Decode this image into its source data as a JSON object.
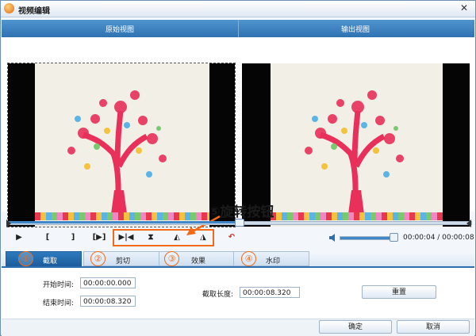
{
  "window": {
    "title": "视频编辑",
    "close_glyph": "✕"
  },
  "views": {
    "original_label": "原始视图",
    "output_label": "输出视图"
  },
  "playback": {
    "buttons": [
      {
        "name": "play-button",
        "glyph": "▶"
      },
      {
        "name": "mark-in-button",
        "glyph": "["
      },
      {
        "name": "mark-out-button",
        "glyph": "]"
      },
      {
        "name": "preview-selection-button",
        "glyph": "[▶]"
      }
    ],
    "rotate_buttons": [
      {
        "name": "flip-horizontal-button",
        "glyph": "▶|◀"
      },
      {
        "name": "flip-vertical-button",
        "glyph": "⧗"
      },
      {
        "name": "rotate-left-button",
        "glyph": "◭"
      },
      {
        "name": "rotate-right-button",
        "glyph": "◮"
      }
    ],
    "undo_glyph": "↶",
    "progress_fraction": 0.5,
    "volume_fraction": 0.95,
    "time_text": "00:00:04 / 00:00:08"
  },
  "annotation": {
    "label": "⑤旋转按钮",
    "color": "#f06a1a"
  },
  "tabs": [
    {
      "number": "①",
      "label": "截取"
    },
    {
      "number": "②",
      "label": "剪切"
    },
    {
      "number": "③",
      "label": "效果"
    },
    {
      "number": "④",
      "label": "水印"
    }
  ],
  "trim": {
    "start_label": "开始时间:",
    "start_value": "00:00:00.000",
    "end_label": "结束时间:",
    "end_value": "00:00:08.320",
    "length_label": "截取长度:",
    "length_value": "00:00:08.320",
    "reset_label": "重置"
  },
  "footer": {
    "ok_label": "确定",
    "cancel_label": "取消"
  },
  "colors": {
    "accent": "#2d6fae",
    "annotation": "#f06a1a",
    "tree": "#e8305a"
  }
}
